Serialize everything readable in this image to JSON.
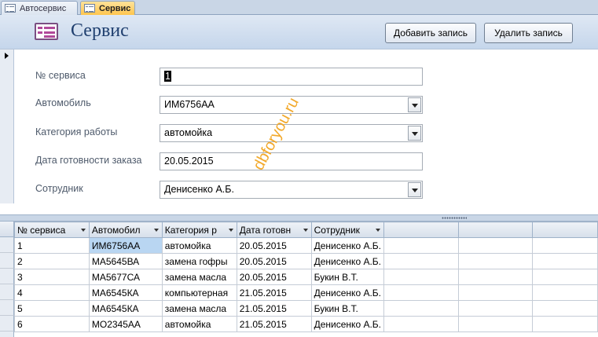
{
  "tabs": [
    {
      "label": "Автосервис",
      "active": false
    },
    {
      "label": "Сервис",
      "active": true
    }
  ],
  "header": {
    "title": "Сервис",
    "add_button": "Добавить запись",
    "delete_button": "Удалить запись"
  },
  "form": {
    "fields": [
      {
        "label": "№ сервиса",
        "value": "1",
        "type": "text"
      },
      {
        "label": "Автомобиль",
        "value": "ИМ6756АА",
        "type": "combo"
      },
      {
        "label": "Категория работы",
        "value": "автомойка",
        "type": "combo"
      },
      {
        "label": "Дата готовности заказа",
        "value": "20.05.2015",
        "type": "text"
      },
      {
        "label": "Сотрудник",
        "value": "Денисенко А.Б.",
        "type": "combo"
      }
    ]
  },
  "watermark": "dbforyou.ru",
  "datasheet": {
    "columns": [
      "№ сервиса",
      "Автомобил",
      "Категория р",
      "Дата готовн",
      "Сотрудник"
    ],
    "rows": [
      [
        "1",
        "ИМ6756АА",
        "автомойка",
        "20.05.2015",
        "Денисенко А.Б."
      ],
      [
        "2",
        "МА5645ВА",
        "замена гофры",
        "20.05.2015",
        "Денисенко А.Б."
      ],
      [
        "3",
        "МА5677СА",
        "замена масла",
        "20.05.2015",
        "Букин В.Т."
      ],
      [
        "4",
        "МА6545КА",
        "компьютерная",
        "21.05.2015",
        "Денисенко А.Б."
      ],
      [
        "5",
        "МА6545КА",
        "замена масла",
        "21.05.2015",
        "Букин В.Т."
      ],
      [
        "6",
        "МО2345АА",
        "автомойка",
        "21.05.2015",
        "Денисенко А.Б."
      ]
    ]
  },
  "colors": {
    "header_bg": "#c5d6eb",
    "title_color": "#1f3f6f",
    "active_tab": "#ffc54e",
    "selected_cell": "#b9d6f2",
    "watermark": "#f2a92b"
  }
}
